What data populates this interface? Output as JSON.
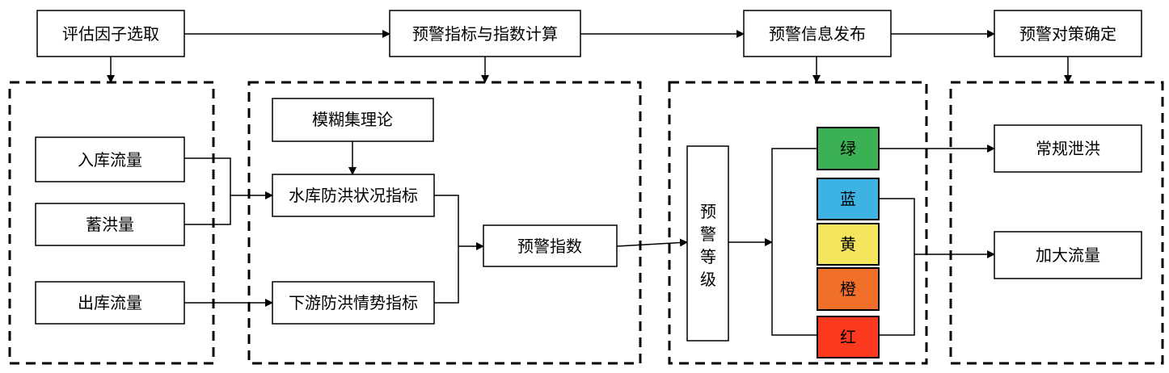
{
  "stages": [
    "评估因子选取",
    "预警指标与指数计算",
    "预警信息发布",
    "预警对策确定"
  ],
  "factors": [
    "入库流量",
    "蓄洪量",
    "出库流量"
  ],
  "theory": "模糊集理论",
  "indicators": [
    "水库防洪状况指标",
    "下游防洪情势指标"
  ],
  "warning_index": "预警指数",
  "warning_level": [
    "预",
    "警",
    "等",
    "级"
  ],
  "levels": [
    {
      "label": "绿",
      "color": "#3cb054"
    },
    {
      "label": "蓝",
      "color": "#3db3e3"
    },
    {
      "label": "黄",
      "color": "#f5e45e"
    },
    {
      "label": "橙",
      "color": "#f0702a"
    },
    {
      "label": "红",
      "color": "#fd3a1e"
    }
  ],
  "measures": [
    "常规泄洪",
    "加大流量"
  ]
}
